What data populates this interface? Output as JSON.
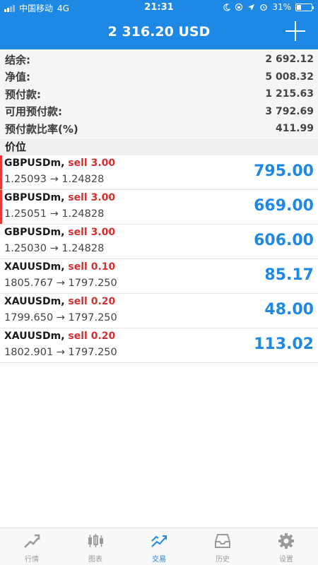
{
  "status_bar": {
    "carrier": "中国移动",
    "network": "4G",
    "time": "21:31",
    "battery": "31%",
    "battery_level": 0.31
  },
  "header": {
    "balance": "2 316.20 USD",
    "add_icon": "plus-icon"
  },
  "summary": [
    {
      "label": "结余:",
      "value": "2 692.12"
    },
    {
      "label": "净值:",
      "value": "5 008.32"
    },
    {
      "label": "预付款:",
      "value": "1 215.63"
    },
    {
      "label": "可用预付款:",
      "value": "3 792.69"
    },
    {
      "label": "预付款比率(%)",
      "value": "411.99"
    }
  ],
  "section": {
    "title": "价位"
  },
  "positions": [
    {
      "symbol": "GBPUSDm,",
      "side": "sell 3.00",
      "prices": "1.25093 → 1.24828",
      "profit": "795.00",
      "marked": true
    },
    {
      "symbol": "GBPUSDm,",
      "side": "sell 3.00",
      "prices": "1.25051 → 1.24828",
      "profit": "669.00",
      "marked": true
    },
    {
      "symbol": "GBPUSDm,",
      "side": "sell 3.00",
      "prices": "1.25030 → 1.24828",
      "profit": "606.00",
      "marked": false
    },
    {
      "symbol": "XAUUSDm,",
      "side": "sell 0.10",
      "prices": "1805.767 → 1797.250",
      "profit": "85.17",
      "marked": false
    },
    {
      "symbol": "XAUUSDm,",
      "side": "sell 0.20",
      "prices": "1799.650 → 1797.250",
      "profit": "48.00",
      "marked": false
    },
    {
      "symbol": "XAUUSDm,",
      "side": "sell 0.20",
      "prices": "1802.901 → 1797.250",
      "profit": "113.02",
      "marked": false
    }
  ],
  "tabs": [
    {
      "label": "行情",
      "icon": "quotes-icon",
      "active": false
    },
    {
      "label": "图表",
      "icon": "chart-icon",
      "active": false
    },
    {
      "label": "交易",
      "icon": "trade-icon",
      "active": true
    },
    {
      "label": "历史",
      "icon": "history-icon",
      "active": false
    },
    {
      "label": "设置",
      "icon": "settings-icon",
      "active": false
    }
  ],
  "colors": {
    "header": "#1e88e5",
    "profit": "#1e88e5",
    "sell": "#d32f2f",
    "marker": "#e53935"
  }
}
